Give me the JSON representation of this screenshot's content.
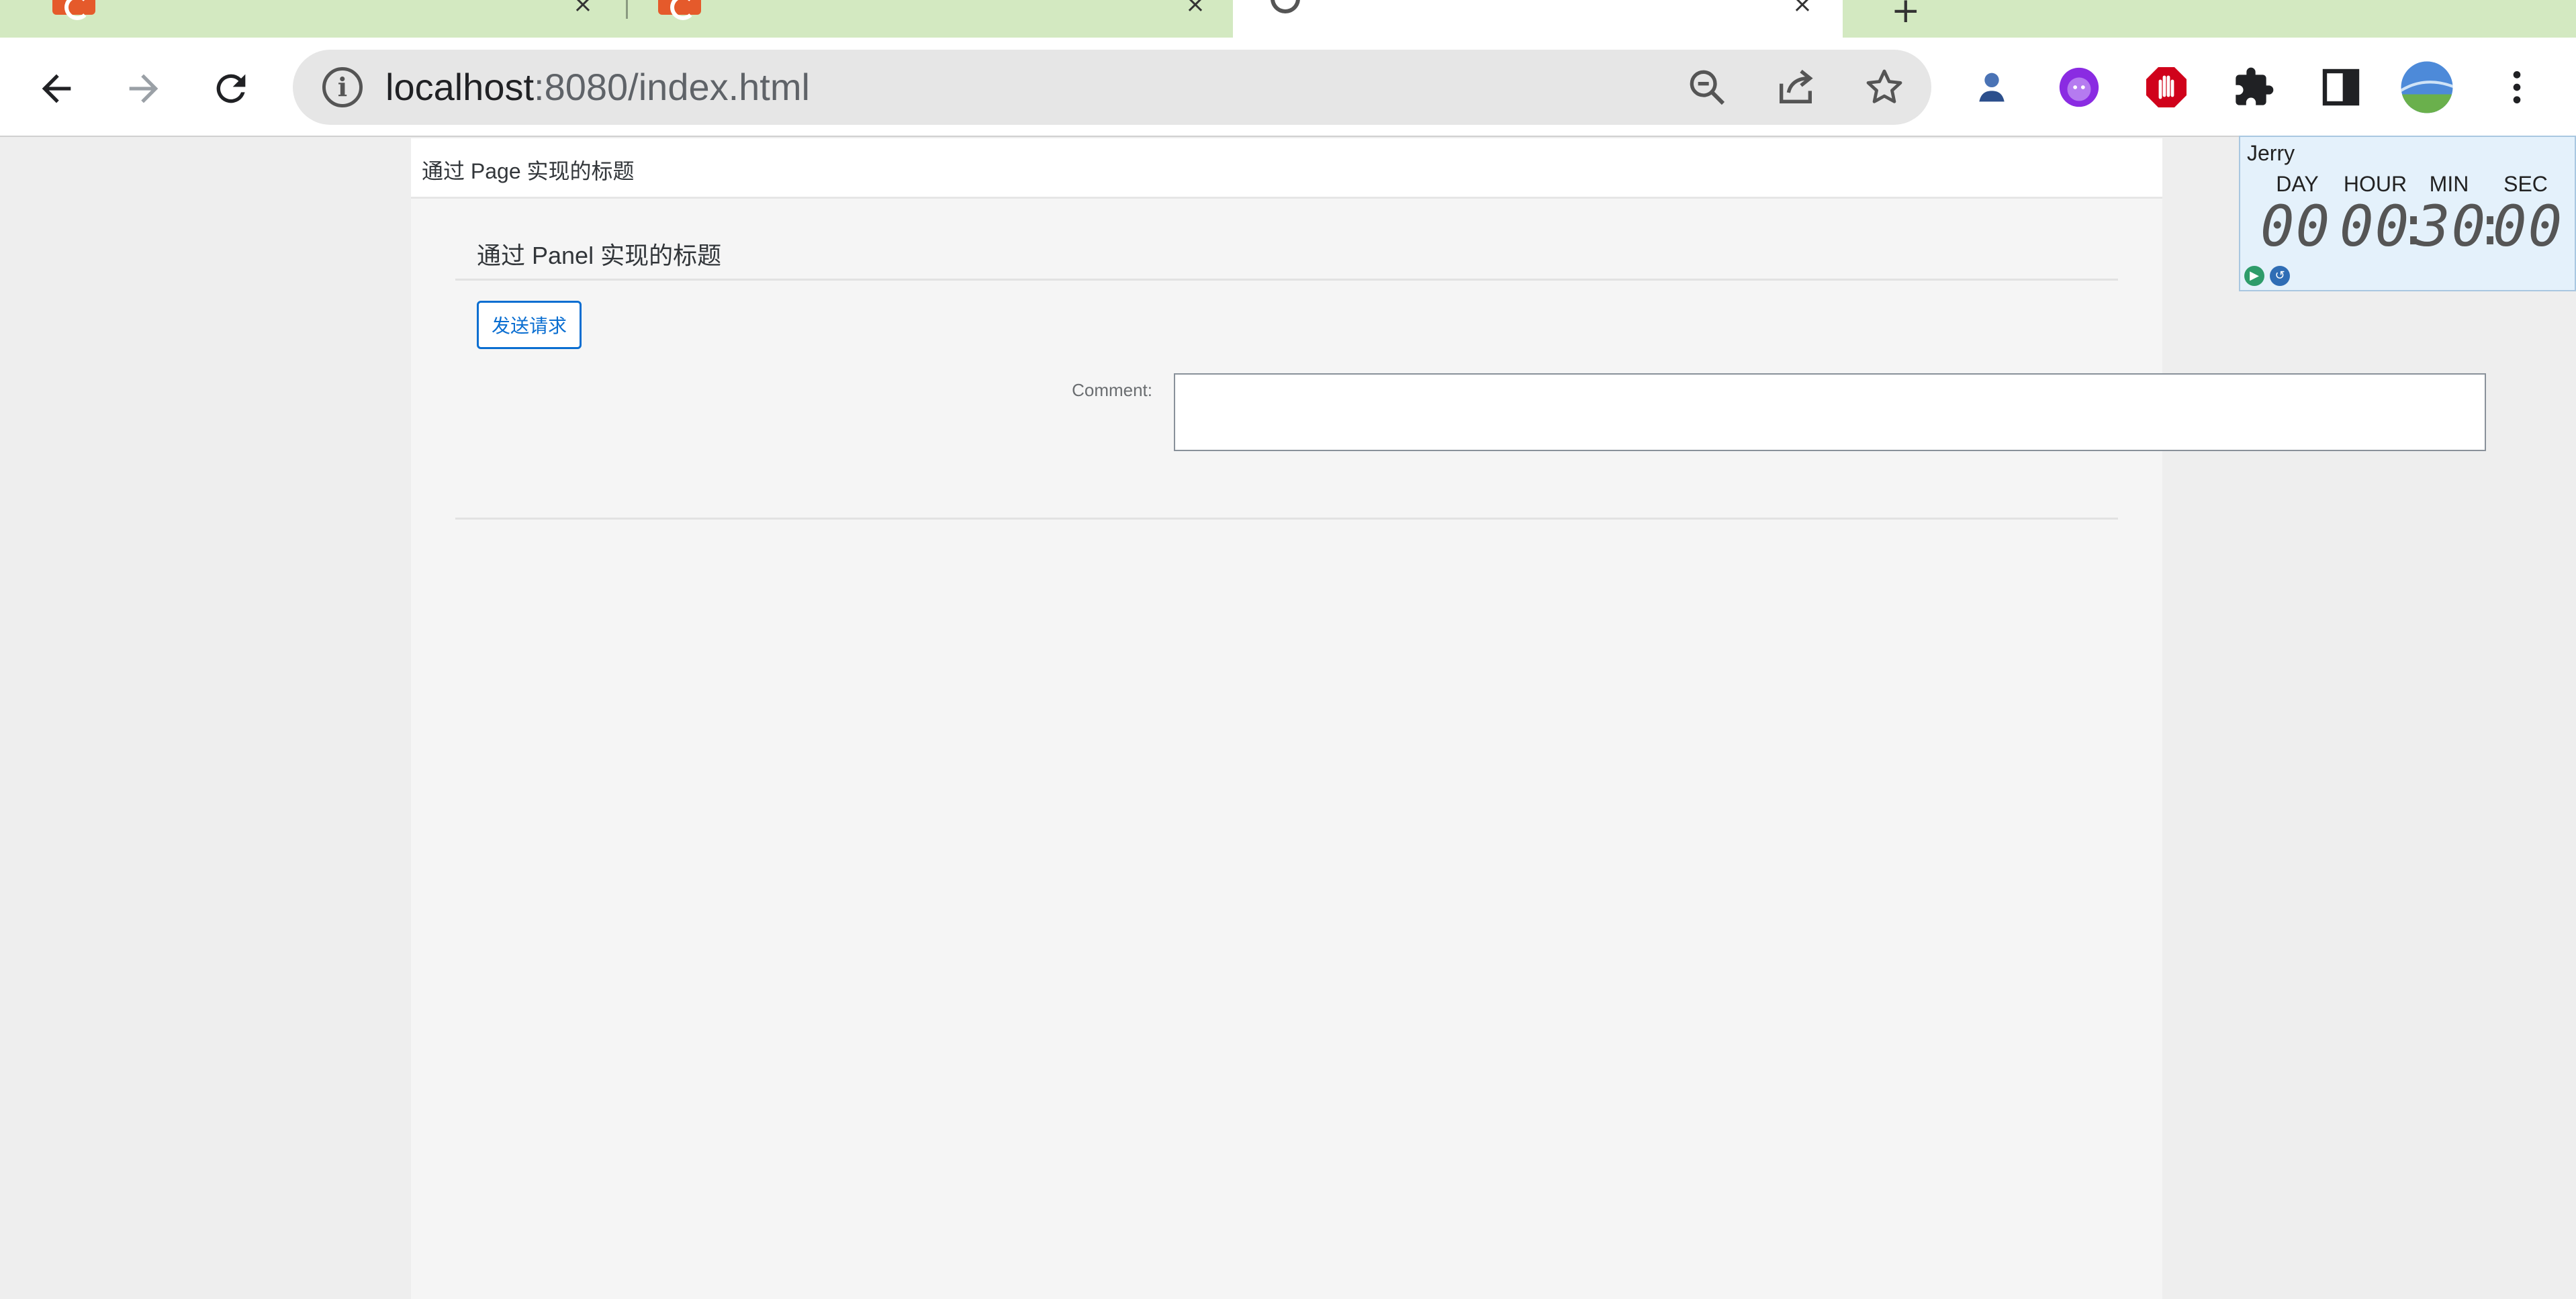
{
  "browser": {
    "url_host": "localhost",
    "url_rest": ":8080/index.html"
  },
  "page": {
    "title": "通过 Page 实现的标题"
  },
  "panel": {
    "title": "通过 Panel 实现的标题",
    "send_button": "发送请求",
    "comment_label": "Comment:",
    "comment_value": ""
  },
  "timer": {
    "name": "Jerry",
    "labels": {
      "day": "DAY",
      "hour": "HOUR",
      "min": "MIN",
      "sec": "SEC"
    },
    "values": {
      "day": "00",
      "hour": "00",
      "min": "30",
      "sec": "00"
    },
    "separator": ":"
  },
  "colors": {
    "tabstrip": "#d3e9c1",
    "accent": "#0a6ed1",
    "page_bg": "#f5f5f5",
    "timer_bg": "#e4f1fb"
  },
  "icons": [
    "back-icon",
    "forward-icon",
    "reload-icon",
    "info-icon",
    "zoom-out-icon",
    "share-icon",
    "star-icon",
    "extension-person-icon",
    "extension-face-icon",
    "extension-stop-hand-icon",
    "puzzle-icon",
    "side-panel-icon",
    "profile-avatar-icon",
    "menu-icon"
  ]
}
